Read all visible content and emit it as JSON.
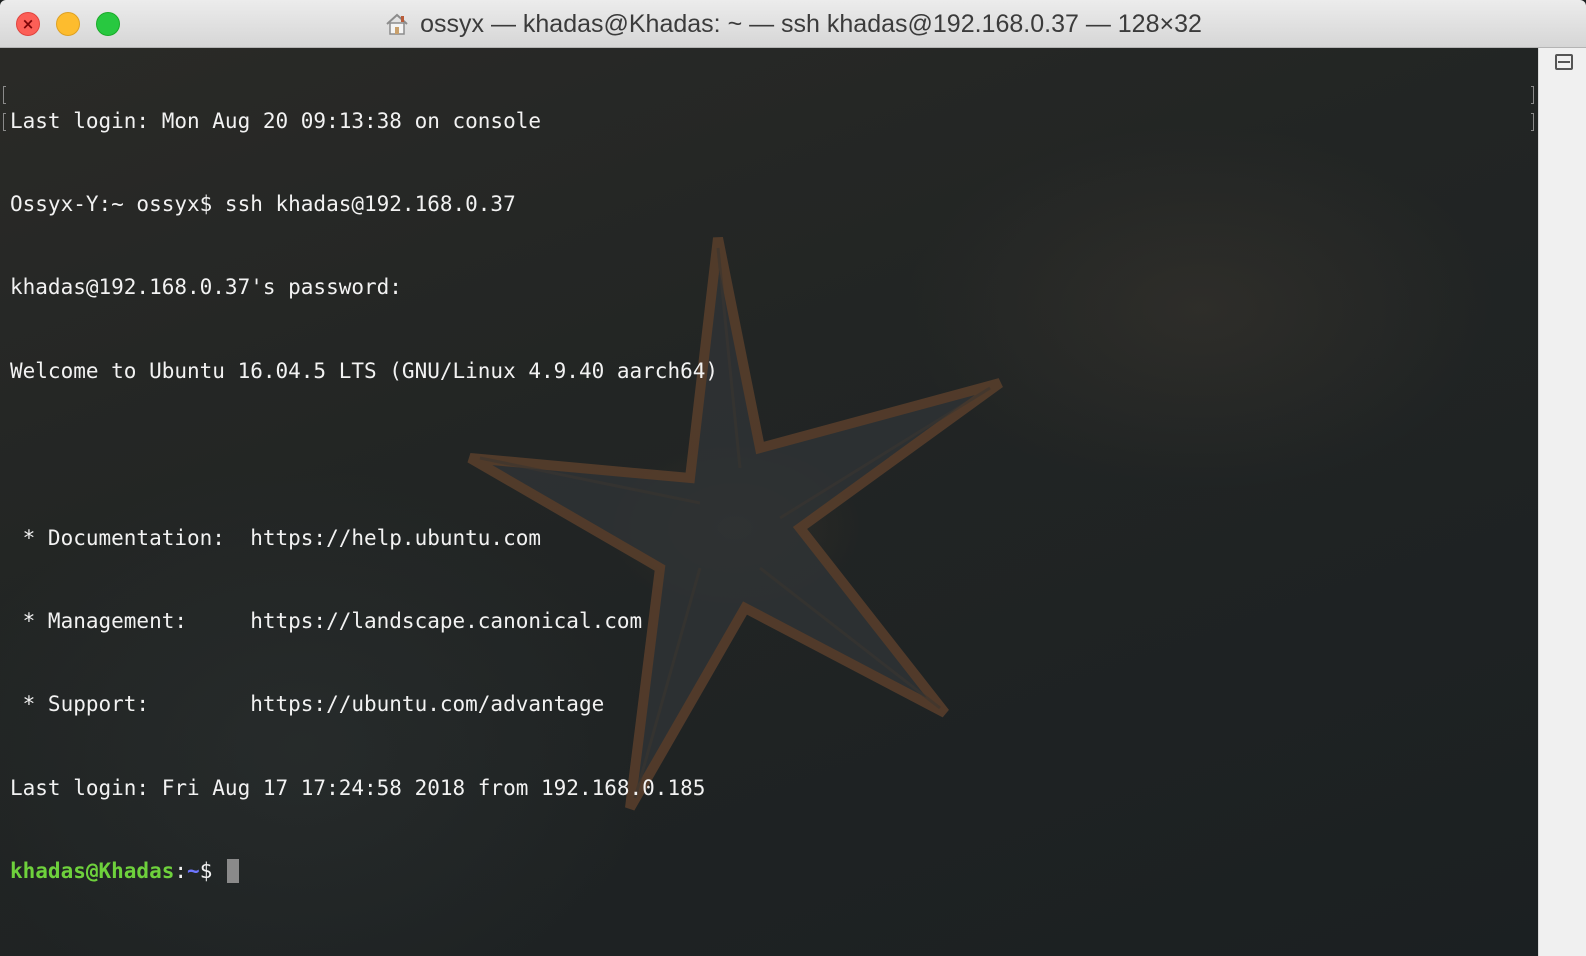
{
  "window": {
    "title": "ossyx — khadas@Khadas: ~ — ssh khadas@192.168.0.37 — 128×32",
    "close_glyph": "×"
  },
  "terminal": {
    "lines": [
      "Last login: Mon Aug 20 09:13:38 on console",
      "Ossyx-Y:~ ossyx$ ssh khadas@192.168.0.37",
      "khadas@192.168.0.37's password:",
      "Welcome to Ubuntu 16.04.5 LTS (GNU/Linux 4.9.40 aarch64)",
      "",
      " * Documentation:  https://help.ubuntu.com",
      " * Management:     https://landscape.canonical.com",
      " * Support:        https://ubuntu.com/advantage",
      "Last login: Fri Aug 17 17:24:58 2018 from 192.168.0.185"
    ],
    "prompt": {
      "user_host": "khadas@Khadas",
      "separator": ":",
      "path": "~",
      "symbol": "$ "
    }
  },
  "colors": {
    "prompt_user": "#6ed13c",
    "prompt_path": "#6e76ff",
    "text": "#f2f2f2"
  },
  "icons": {
    "title": "home-icon",
    "scrollbar": "split-pane-icon"
  }
}
